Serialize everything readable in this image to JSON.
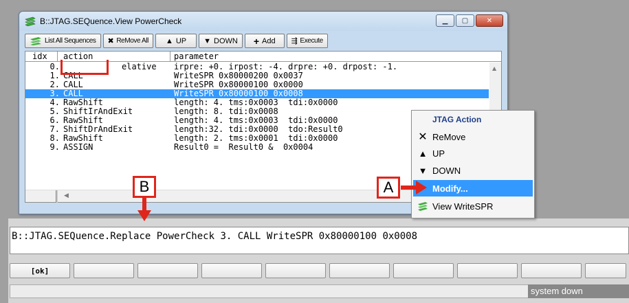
{
  "window": {
    "title": "B::JTAG.SEQuence.View PowerCheck",
    "minimize": "▁",
    "maximize": "▢",
    "close": "✕"
  },
  "toolbar": {
    "list_all": "List All Sequences",
    "remove_all": "ReMove All",
    "up": "UP",
    "down": "DOWN",
    "add": "Add",
    "execute": "Execute"
  },
  "table": {
    "headers": {
      "idx": "idx",
      "action": "action",
      "parameter": "parameter"
    },
    "rows": [
      {
        "idx": "0.",
        "action": "elative",
        "parameter": "irpre: +0. irpost: -4. drpre: +0. drpost: -1."
      },
      {
        "idx": "1.",
        "action": "CALL",
        "parameter": "WriteSPR 0x80000200 0x0037"
      },
      {
        "idx": "2.",
        "action": "CALL",
        "parameter": "WriteSPR 0x80000100 0x0000"
      },
      {
        "idx": "3.",
        "action": "CALL",
        "parameter": "WriteSPR 0x80000100 0x0008"
      },
      {
        "idx": "4.",
        "action": "RawShift",
        "parameter": "length: 4. tms:0x0003  tdi:0x0000"
      },
      {
        "idx": "5.",
        "action": "ShiftIrAndExit",
        "parameter": "length: 8. tdi:0x0008"
      },
      {
        "idx": "6.",
        "action": "RawShift",
        "parameter": "length: 4. tms:0x0003  tdi:0x0000"
      },
      {
        "idx": "7.",
        "action": "ShiftDrAndExit",
        "parameter": "length:32. tdi:0x0000  tdo:Result0"
      },
      {
        "idx": "8.",
        "action": "RawShift",
        "parameter": "length: 2. tms:0x0001  tdi:0x0000"
      },
      {
        "idx": "9.",
        "action": "ASSIGN",
        "parameter": "Result0 =  Result0 &  0x0004"
      }
    ],
    "selected_index": 3
  },
  "context_menu": {
    "title": "JTAG Action",
    "items": [
      "ReMove",
      "UP",
      "DOWN",
      "Modify...",
      "View WriteSPR"
    ],
    "highlighted": "Modify..."
  },
  "callouts": {
    "a": "A",
    "b": "B"
  },
  "command_line": {
    "prompt": "B::",
    "value": "JTAG.SEQuence.Replace PowerCheck 3. CALL WriteSPR 0x80000100 0x0008"
  },
  "softkeys": {
    "first": "[ok]"
  },
  "status": {
    "right": "system down"
  },
  "colors": {
    "selection": "#3399ff",
    "callout": "#e0251b",
    "menu_title": "#1f3f8a"
  }
}
